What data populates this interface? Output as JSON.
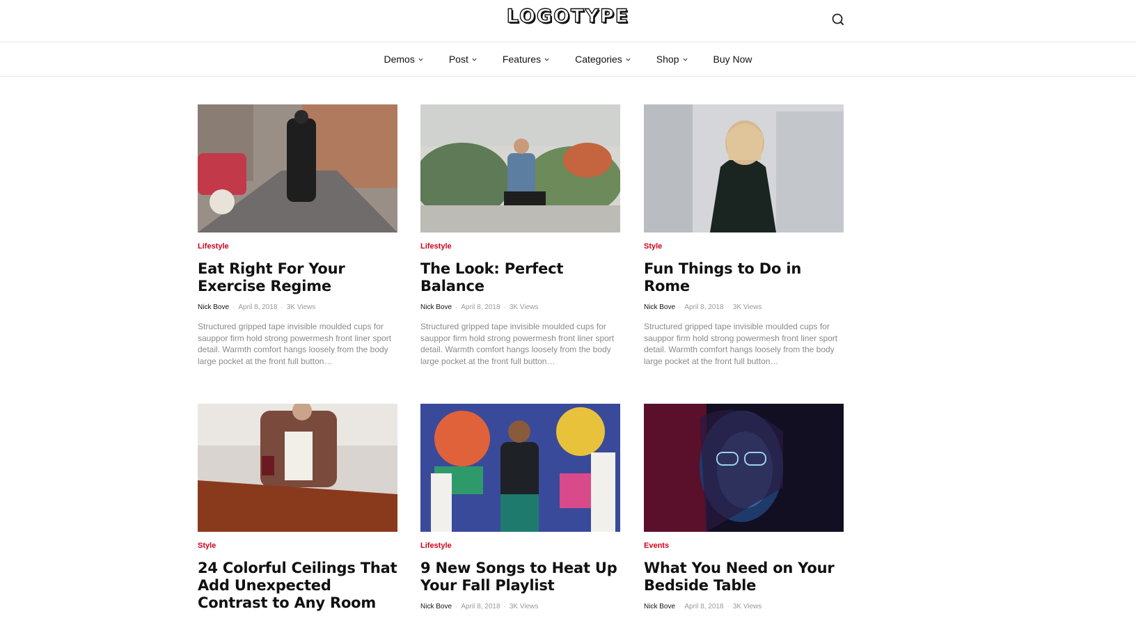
{
  "header": {
    "logo": "LOGOTYPE"
  },
  "nav": {
    "items": [
      {
        "label": "Demos",
        "dropdown": true
      },
      {
        "label": "Post",
        "dropdown": true
      },
      {
        "label": "Features",
        "dropdown": true
      },
      {
        "label": "Categories",
        "dropdown": true
      },
      {
        "label": "Shop",
        "dropdown": true
      },
      {
        "label": "Buy Now",
        "dropdown": false
      }
    ]
  },
  "colors": {
    "category": "#d0021b",
    "text": "#111111",
    "muted": "#999999"
  },
  "posts": [
    {
      "category": "Lifestyle",
      "title": "Eat Right For Your Exercise Regime",
      "author": "Nick Bove",
      "date": "April 8, 2018",
      "views": "3K Views",
      "excerpt": "Structured gripped tape invisible moulded cups for sauppor firm hold strong powermesh front liner sport detail. Warmth comfort hangs loosely from the body large pocket at the front full button…"
    },
    {
      "category": "Lifestyle",
      "title": "The Look: Perfect Balance",
      "author": "Nick Bove",
      "date": "April 8, 2018",
      "views": "3K Views",
      "excerpt": "Structured gripped tape invisible moulded cups for sauppor firm hold strong powermesh front liner sport detail. Warmth comfort hangs loosely from the body large pocket at the front full button…"
    },
    {
      "category": "Style",
      "title": "Fun Things to Do in Rome",
      "author": "Nick Bove",
      "date": "April 8, 2018",
      "views": "3K Views",
      "excerpt": "Structured gripped tape invisible moulded cups for sauppor firm hold strong powermesh front liner sport detail. Warmth comfort hangs loosely from the body large pocket at the front full button…"
    },
    {
      "category": "Style",
      "title": "24 Colorful Ceilings That Add Unexpected Contrast to Any Room",
      "author": "",
      "date": "",
      "views": "",
      "excerpt": ""
    },
    {
      "category": "Lifestyle",
      "title": "9 New Songs to Heat Up Your Fall Playlist",
      "author": "Nick Bove",
      "date": "April 8, 2018",
      "views": "3K Views",
      "excerpt": ""
    },
    {
      "category": "Events",
      "title": "What You Need on Your Bedside Table",
      "author": "Nick Bove",
      "date": "April 8, 2018",
      "views": "3K Views",
      "excerpt": ""
    }
  ]
}
